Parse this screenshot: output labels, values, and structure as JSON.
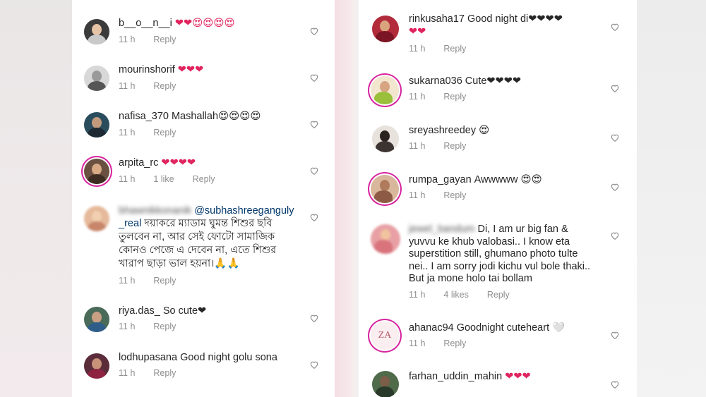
{
  "left_comments": [
    {
      "username": "b__o__n__i",
      "text": "❤❤😍😍😍😍",
      "time": "11 h",
      "reply": "Reply",
      "likes": ""
    },
    {
      "username": "mourinshorif",
      "text": "❤❤❤",
      "time": "11 h",
      "reply": "Reply",
      "likes": ""
    },
    {
      "username": "nafisa_370",
      "text": "Mashallah😍😍😍😍",
      "time": "11 h",
      "reply": "Reply",
      "likes": ""
    },
    {
      "username": "arpita_rc",
      "text": "❤❤❤❤",
      "time": "11 h",
      "reply": "Reply",
      "likes": "1 like"
    },
    {
      "username": "bhawnikkonanik",
      "mention": "@subhashreeganguly",
      "mention_cont": "_real",
      "text": "দয়াকরে ম্যাডাম ঘুমন্ত শিশুর ছবি তুলবেন না, আর সেই ফোটো সামাজিক কোনও পেজে এ দেবেন না, এতে শিশুর খারাপ ছাড়া ভাল হয়না।🙏🙏",
      "time": "11 h",
      "reply": "Reply",
      "likes": ""
    },
    {
      "username": "riya.das_",
      "text": "So cute❤",
      "time": "11 h",
      "reply": "Reply",
      "likes": ""
    },
    {
      "username": "lodhupasana",
      "text": "Good night golu sona",
      "time": "11 h",
      "reply": "Reply",
      "likes": ""
    }
  ],
  "right_comments": [
    {
      "username": "rinkusaha17",
      "text": "Good night di❤❤❤❤",
      "text2": "❤❤",
      "time": "11 h",
      "reply": "Reply",
      "likes": ""
    },
    {
      "username": "sukarna036",
      "text": "Cute❤❤❤❤",
      "time": "11 h",
      "reply": "Reply",
      "likes": ""
    },
    {
      "username": "sreyashreedey",
      "text": "😍",
      "time": "11 h",
      "reply": "Reply",
      "likes": ""
    },
    {
      "username": "rumpa_gayan",
      "text": "Awwwww 😍😍",
      "time": "11 h",
      "reply": "Reply",
      "likes": ""
    },
    {
      "username": "jewel_bandum",
      "text_lines": [
        "Di, I am ur big fan &",
        "yuvvu ke khub valobasi.. I know eta",
        "superstition still, ghumano photo tulte",
        "nei.. I am sorry jodi kichu vul bole thaki..",
        "But ja mone holo tai bollam"
      ],
      "time": "11 h",
      "reply": "Reply",
      "likes": "4 likes"
    },
    {
      "username": "ahanac94",
      "text": "Goodnight cuteheart 🤍",
      "time": "11 h",
      "reply": "Reply",
      "likes": ""
    },
    {
      "username": "farhan_uddin_mahin",
      "text": "❤❤❤",
      "time": "",
      "reply": "",
      "likes": ""
    }
  ],
  "bengali_lines": [
    "দয়াকরে ম্যাডাম ঘুমন্ত শিশুর ছবি",
    "তুলবেন না, আর সেই ফোটো সামাজিক",
    "কোনও পেজে এ দেবেন না, এতে শিশুর",
    "খারাপ ছাড়া ভাল হয়না।🙏🙏"
  ],
  "icons": {
    "like": "heart-outline-icon"
  },
  "colors": {
    "heart": "#e0245e",
    "meta": "#8e8e8e",
    "mention": "#00376b",
    "story_ring": "#d6249f"
  }
}
